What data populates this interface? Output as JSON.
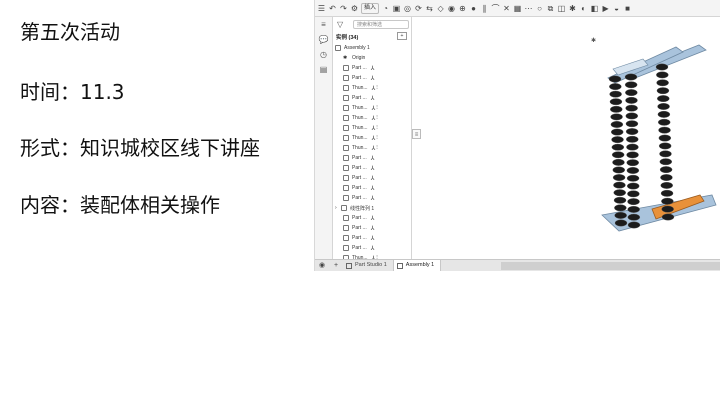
{
  "slide": {
    "line1": "第五次活动",
    "line2": "时间：11.3",
    "line3": "形式：知识城校区线下讲座",
    "line4": "内容：装配体相关操作"
  },
  "app": {
    "toolbar": {
      "insert_label": "插入"
    },
    "panel": {
      "filter_placeholder": "搜索和筛选",
      "instances_label": "实例 (34)",
      "tree": [
        {
          "label": "Assembly 1",
          "kind": "assembly"
        },
        {
          "label": "Origin",
          "kind": "origin"
        },
        {
          "label": "Part ...",
          "mate": true,
          "pin": false
        },
        {
          "label": "Part ...",
          "mate": true,
          "pin": false
        },
        {
          "label": "Thun...",
          "mate": true,
          "pin": true
        },
        {
          "label": "Part ...",
          "mate": true,
          "pin": false
        },
        {
          "label": "Thun...",
          "mate": true,
          "pin": true
        },
        {
          "label": "Thun...",
          "mate": true,
          "pin": true
        },
        {
          "label": "Thun...",
          "mate": true,
          "pin": true
        },
        {
          "label": "Thun...",
          "mate": true,
          "pin": true
        },
        {
          "label": "Thun...",
          "mate": true,
          "pin": true
        },
        {
          "label": "Part ...",
          "mate": true,
          "pin": false
        },
        {
          "label": "Part ...",
          "mate": true,
          "pin": false
        },
        {
          "label": "Part ...",
          "mate": true,
          "pin": false
        },
        {
          "label": "Part ...",
          "mate": true,
          "pin": false
        },
        {
          "label": "Part ...",
          "mate": true,
          "pin": false
        },
        {
          "label": "线性阵列 1",
          "kind": "pattern"
        },
        {
          "label": "Part ...",
          "mate": true,
          "pin": false
        },
        {
          "label": "Part ...",
          "mate": true,
          "pin": false
        },
        {
          "label": "Part ...",
          "mate": true,
          "pin": false
        },
        {
          "label": "Part ...",
          "mate": true,
          "pin": false
        },
        {
          "label": "Thun...",
          "mate": true,
          "pin": true
        }
      ]
    },
    "tabs": [
      {
        "label": "Part Studio 1",
        "active": false
      },
      {
        "label": "Assembly 1",
        "active": true
      }
    ],
    "colors": {
      "link": "#a9c3dc",
      "bracket": "#e8913a",
      "chain": "#1c1c1c"
    }
  }
}
